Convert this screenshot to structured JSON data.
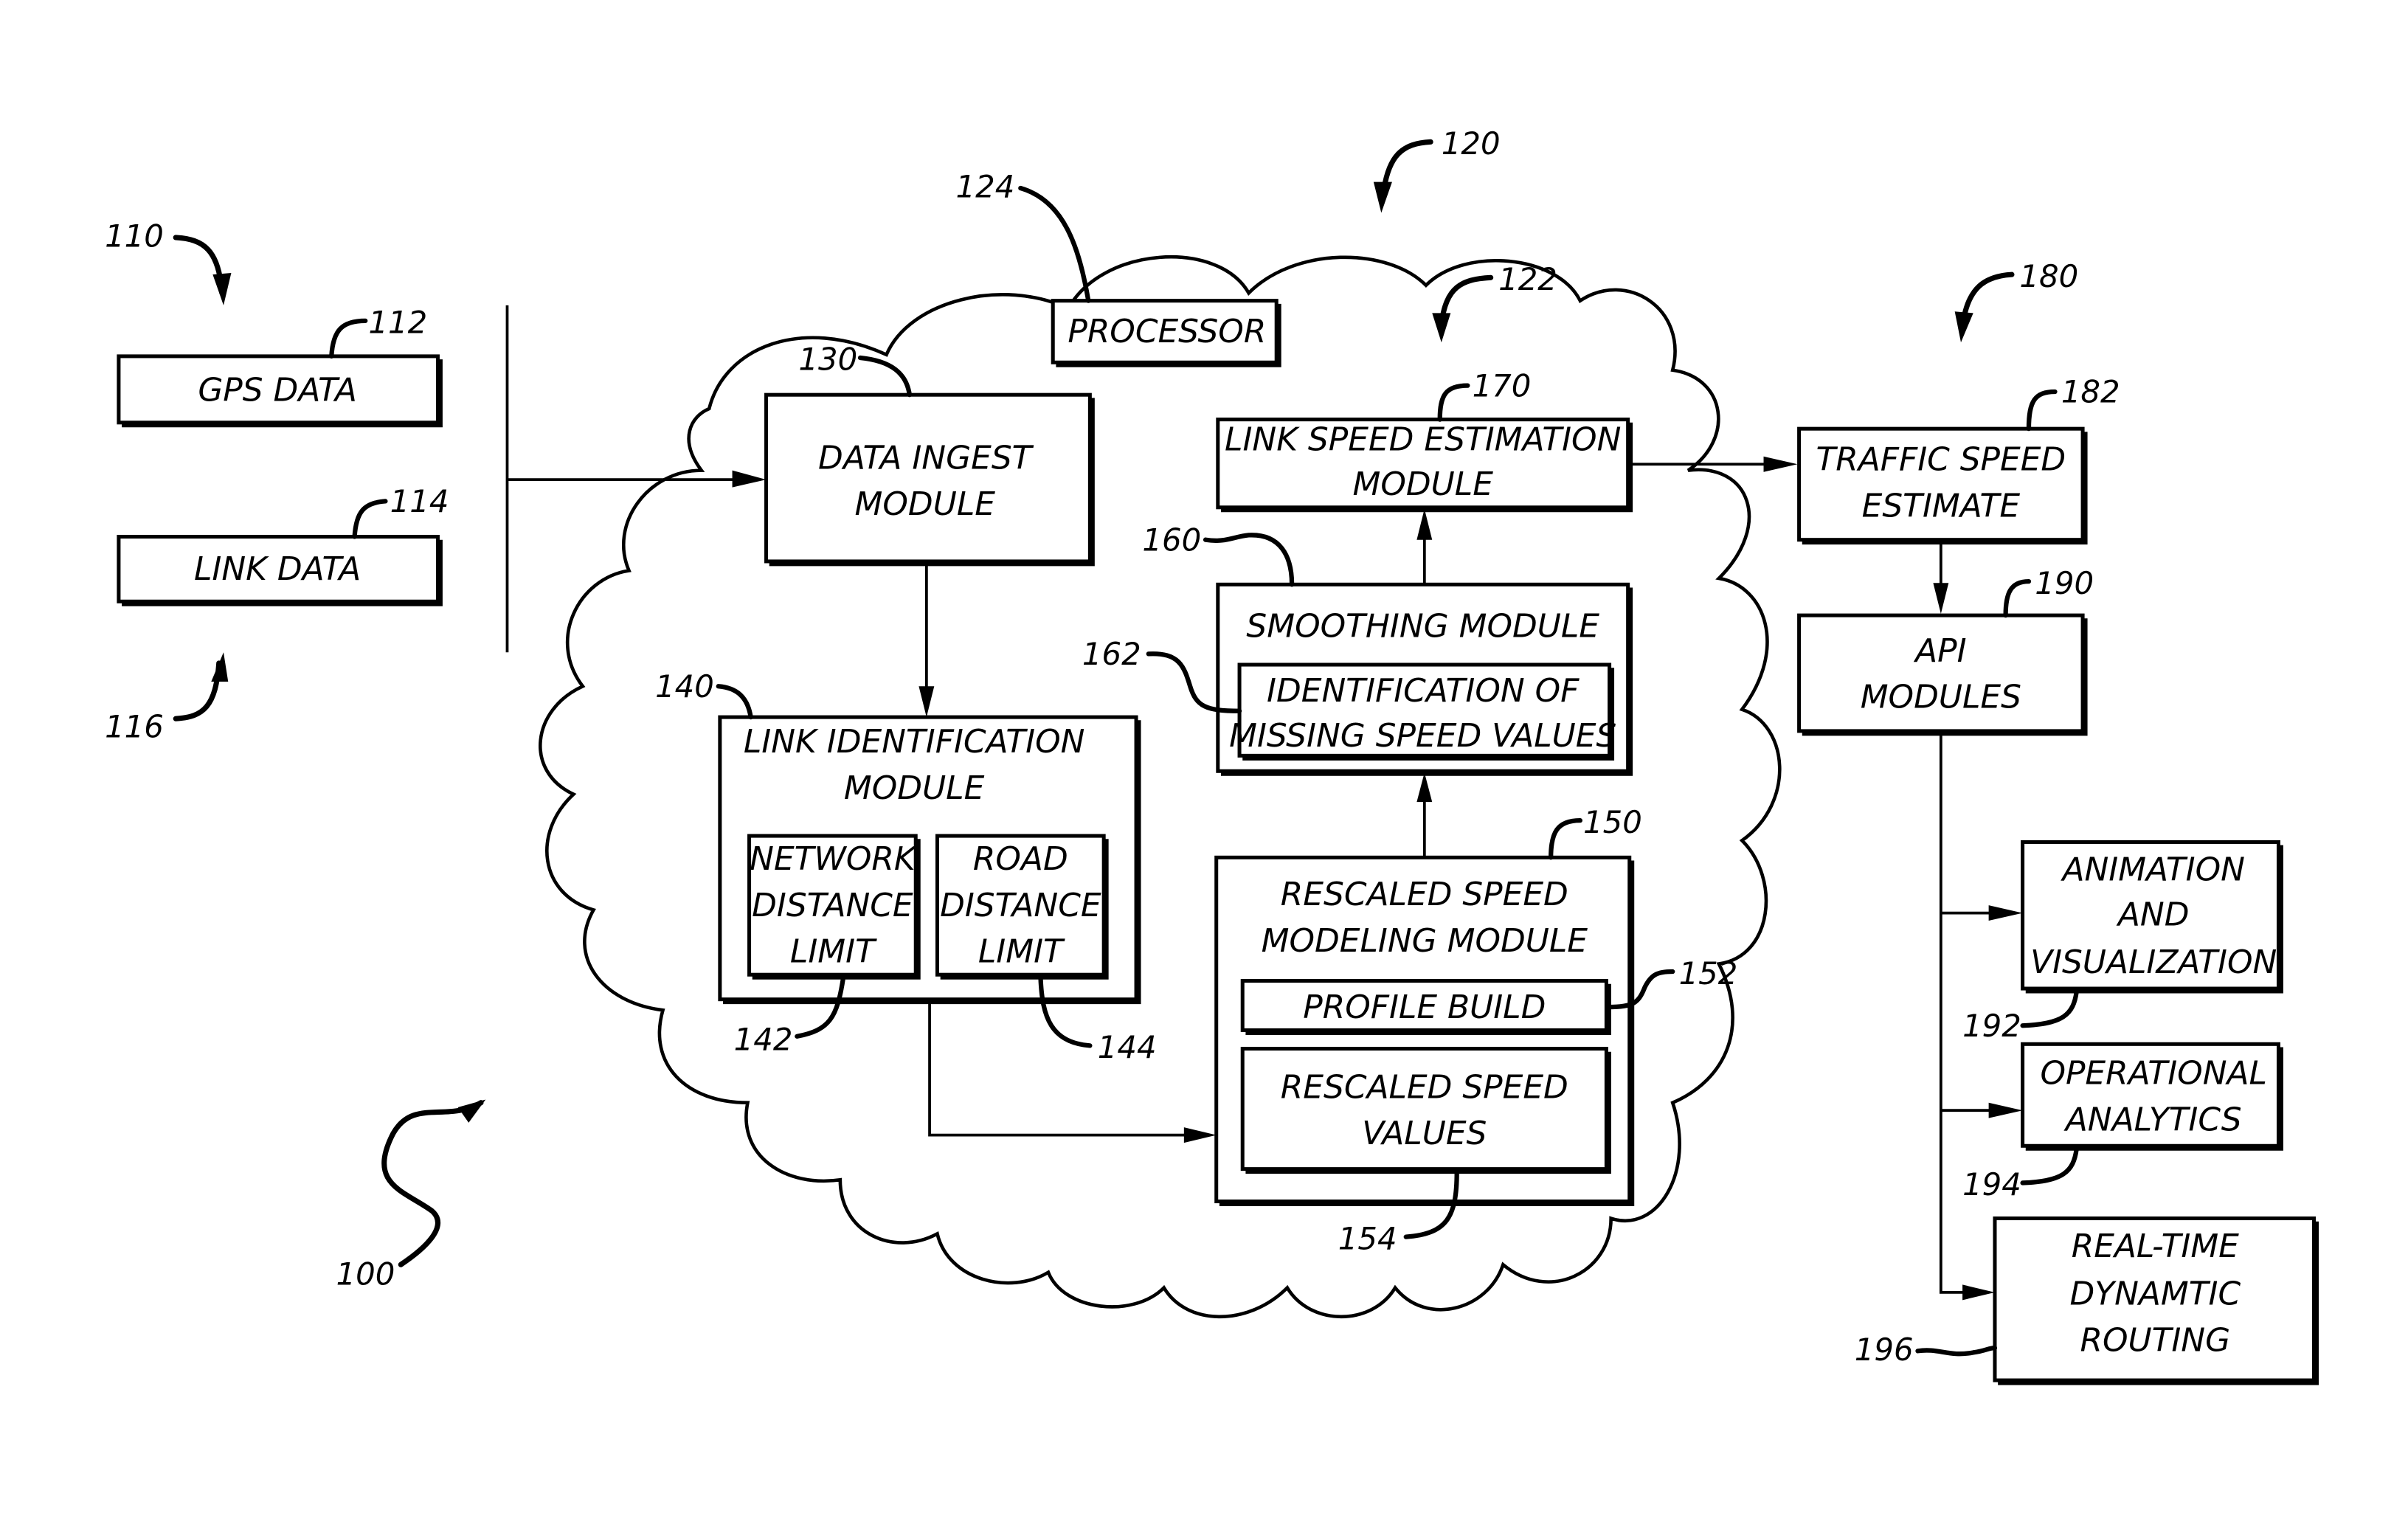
{
  "figure": {
    "system_ref": "100",
    "inputs": {
      "group_ref_top": "110",
      "group_ref_bottom": "116",
      "gps": {
        "label": "GPS DATA",
        "ref": "112"
      },
      "link": {
        "label": "LINK DATA",
        "ref": "114"
      }
    },
    "cloud": {
      "ref": "120",
      "inner_ref": "122",
      "processor": {
        "label": "PROCESSOR",
        "ref": "124"
      },
      "data_ingest": {
        "lines": [
          "DATA INGEST",
          "MODULE"
        ],
        "ref": "130"
      },
      "link_identification": {
        "lines": [
          "LINK IDENTIFICATION",
          "MODULE"
        ],
        "ref": "140",
        "network_limit": {
          "lines": [
            "NETWORK",
            "DISTANCE",
            "LIMIT"
          ],
          "ref": "142"
        },
        "road_limit": {
          "lines": [
            "ROAD",
            "DISTANCE",
            "LIMIT"
          ],
          "ref": "144"
        }
      },
      "rescaled_modeling": {
        "lines": [
          "RESCALED SPEED",
          "MODELING MODULE"
        ],
        "ref": "150",
        "profile_build": {
          "label": "PROFILE BUILD",
          "ref": "152"
        },
        "rescaled_values": {
          "lines": [
            "RESCALED SPEED",
            "VALUES"
          ],
          "ref": "154"
        }
      },
      "smoothing": {
        "label": "SMOOTHING MODULE",
        "ref": "160",
        "missing_values": {
          "lines": [
            "IDENTIFICATION OF",
            "MISSING SPEED VALUES"
          ],
          "ref": "162"
        }
      },
      "link_speed_estimation": {
        "lines": [
          "LINK SPEED ESTIMATION",
          "MODULE"
        ],
        "ref": "170"
      }
    },
    "outputs": {
      "group_ref": "180",
      "traffic_speed": {
        "lines": [
          "TRAFFIC SPEED",
          "ESTIMATE"
        ],
        "ref": "182"
      },
      "api_modules": {
        "lines": [
          "API",
          "MODULES"
        ],
        "ref": "190"
      },
      "animation": {
        "lines": [
          "ANIMATION",
          "AND",
          "VISUALIZATION"
        ],
        "ref": "192"
      },
      "analytics": {
        "lines": [
          "OPERATIONAL",
          "ANALYTICS"
        ],
        "ref": "194"
      },
      "routing": {
        "lines": [
          "REAL-TIME",
          "DYNAMTIC",
          "ROUTING"
        ],
        "ref": "196"
      }
    }
  }
}
